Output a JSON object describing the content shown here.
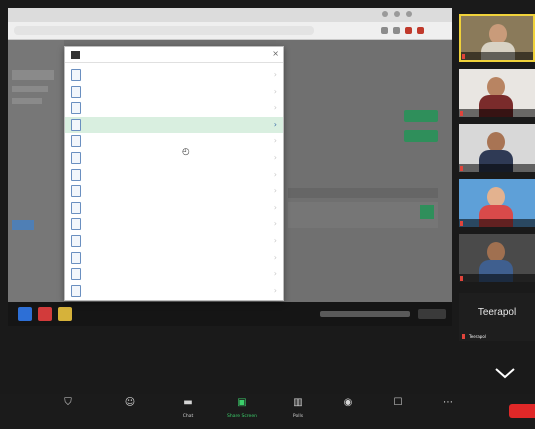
{
  "dialog": {
    "title": "",
    "close": "×",
    "items": [
      {
        "name": "",
        "desc": ""
      },
      {
        "name": "",
        "desc": ""
      },
      {
        "name": "",
        "desc": ""
      },
      {
        "name": "",
        "desc": "",
        "selected": true
      },
      {
        "name": "",
        "desc": ""
      },
      {
        "name": "",
        "desc": ""
      },
      {
        "name": "",
        "desc": ""
      },
      {
        "name": "",
        "desc": ""
      },
      {
        "name": "",
        "desc": ""
      },
      {
        "name": "",
        "desc": ""
      },
      {
        "name": "",
        "desc": ""
      },
      {
        "name": "",
        "desc": ""
      },
      {
        "name": "",
        "desc": ""
      },
      {
        "name": "",
        "desc": ""
      }
    ]
  },
  "participants": {
    "tiles": [
      {
        "name": "",
        "active": true
      },
      {
        "name": ""
      },
      {
        "name": ""
      },
      {
        "name": ""
      },
      {
        "name": ""
      }
    ],
    "name_only": {
      "big": "Teerapol",
      "small": "Teerapol"
    }
  },
  "toolbar": {
    "items": [
      {
        "label": "",
        "icon": "shield-icon"
      },
      {
        "label": "",
        "icon": "participants-icon"
      },
      {
        "label": "Chat",
        "icon": "chat-icon"
      },
      {
        "label": "Share Screen",
        "icon": "share-screen-icon",
        "green": true
      },
      {
        "label": "Polls",
        "icon": "polls-icon"
      },
      {
        "label": "",
        "icon": "record-icon"
      },
      {
        "label": "",
        "icon": "reactions-icon"
      },
      {
        "label": "",
        "icon": "more-icon"
      }
    ],
    "end_label": ""
  }
}
